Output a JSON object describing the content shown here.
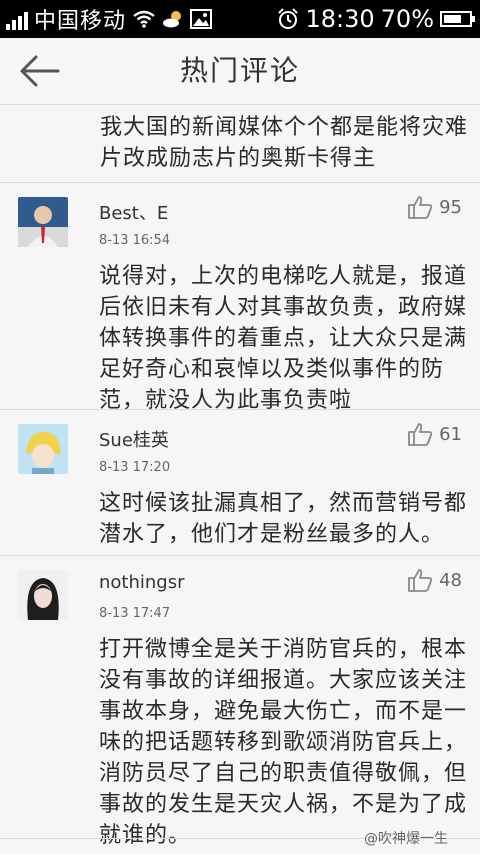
{
  "status_bar": {
    "carrier": "中国移动",
    "time": "18:30",
    "battery": "70%",
    "battery_level": 0.7
  },
  "header": {
    "title": "热门评论",
    "back_icon": "back-arrow-icon"
  },
  "continued_text": "我大国的新闻媒体个个都是能将灾难片改成励志片的奥斯卡得主",
  "comments": [
    {
      "name": "Best、E",
      "time": "8-13 16:54",
      "likes": "95",
      "text": "说得对，上次的电梯吃人就是，报道后依旧未有人对其事故负责，政府媒体转换事件的着重点，让大众只是满足好奇心和哀悼以及类似事件的防范，就没人为此事负责啦"
    },
    {
      "name": "Sue桂英",
      "time": "8-13 17:20",
      "likes": "61",
      "text": "这时候该扯漏真相了，然而营销号都潜水了，他们才是粉丝最多的人。"
    },
    {
      "name": "nothingsr",
      "time": "8-13 17:47",
      "likes": "48",
      "text": "打开微博全是关于消防官兵的，根本没有事故的详细报道。大家应该关注事故本身，避免最大伤亡，而不是一味的把话题转移到歌颂消防官兵上，消防员尽了自己的职责值得敬佩，但事故的发生是天灾人祸，不是为了成就谁的。"
    }
  ],
  "watermark": "@吹神爆一生",
  "colors": {
    "background": "#f6f6f6",
    "status_bar": "#000000",
    "divider": "#dcdcdc"
  }
}
